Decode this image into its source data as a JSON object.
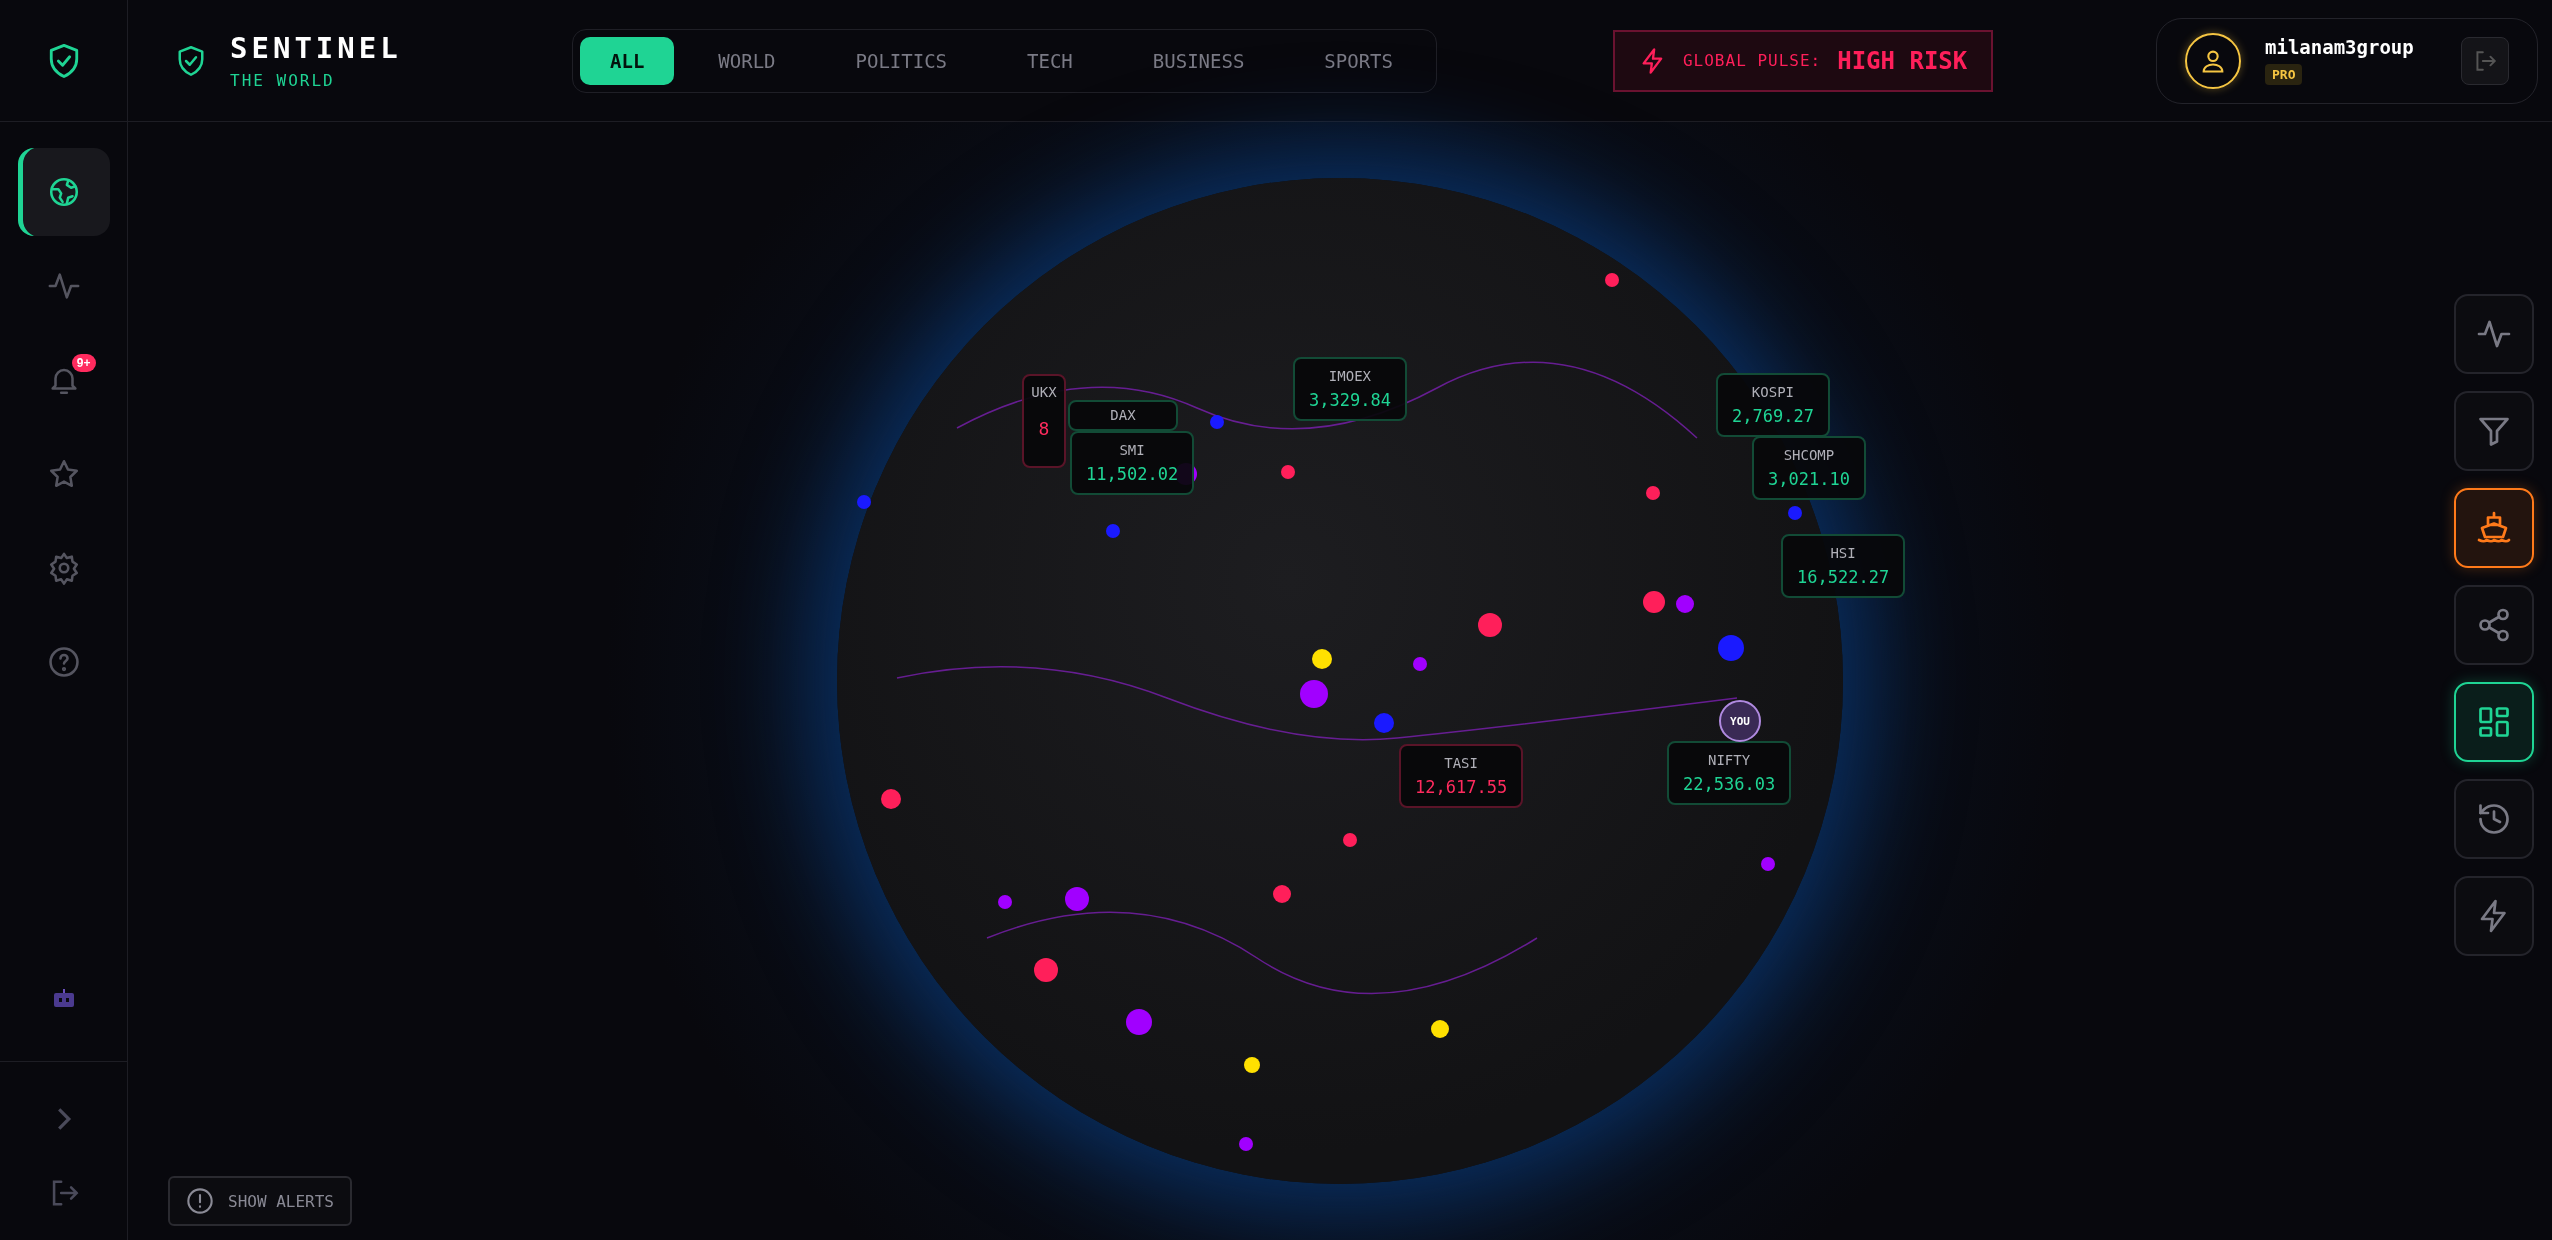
{
  "sidebar": {
    "items": [
      {
        "selected": true
      },
      {
        "selected": false
      },
      {
        "selected": false,
        "badge": "9+"
      },
      {
        "selected": false
      },
      {
        "selected": false
      },
      {
        "selected": false
      }
    ]
  },
  "header": {
    "brand": "SENTINEL",
    "subtitle": "THE WORLD"
  },
  "tabs": [
    {
      "label": "ALL",
      "selected": true
    },
    {
      "label": "WORLD",
      "selected": false
    },
    {
      "label": "POLITICS",
      "selected": false
    },
    {
      "label": "TECH",
      "selected": false
    },
    {
      "label": "BUSINESS",
      "selected": false
    },
    {
      "label": "SPORTS",
      "selected": false
    }
  ],
  "pulse": {
    "label": "GLOBAL PULSE:",
    "value": "HIGH RISK"
  },
  "user": {
    "name": "milanam3group",
    "plan": "PRO"
  },
  "markets": [
    {
      "symbol": "UKX",
      "value": "8",
      "falling": true
    },
    {
      "symbol": "DAX",
      "falling": false
    },
    {
      "symbol": "SMI",
      "value": "11,502.02",
      "falling": false
    },
    {
      "symbol": "IMOEX",
      "value": "3,329.84",
      "falling": false
    },
    {
      "symbol": "KOSPI",
      "value": "2,769.27",
      "falling": false
    },
    {
      "symbol": "SHCOMP",
      "value": "3,021.10",
      "falling": false
    },
    {
      "symbol": "HSI",
      "value": "16,522.27",
      "falling": false
    },
    {
      "symbol": "TASI",
      "value": "12,617.55",
      "falling": true
    },
    {
      "symbol": "NIFTY",
      "value": "22,536.03",
      "falling": false
    }
  ],
  "location_marker": "YOU",
  "toolbar": [
    {
      "active": false
    },
    {
      "active": false
    },
    {
      "active": true,
      "color": "#ff7a1a"
    },
    {
      "active": false
    },
    {
      "active": true,
      "color": "#1fd494"
    },
    {
      "active": false
    },
    {
      "active": false
    }
  ],
  "alerts_button": "SHOW ALERTS"
}
